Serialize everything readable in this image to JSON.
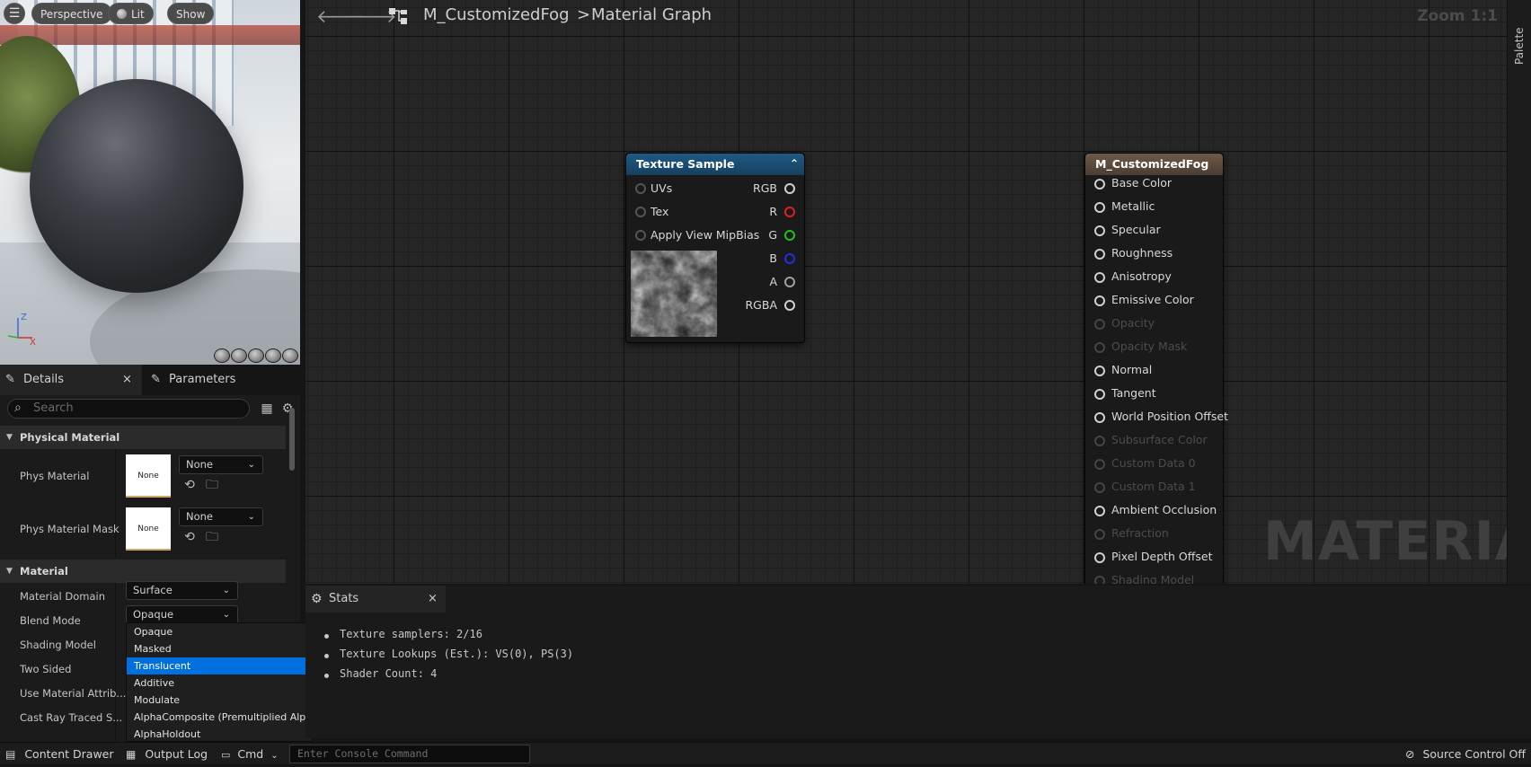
{
  "viewport": {
    "buttons": {
      "perspective": "Perspective",
      "lit": "Lit",
      "show": "Show"
    },
    "axis": {
      "z": "Z",
      "x": "X"
    }
  },
  "details": {
    "tabs": {
      "details": "Details",
      "parameters": "Parameters"
    },
    "search_placeholder": "Search",
    "sections": {
      "physical_material": "Physical Material",
      "material": "Material"
    },
    "phys_material": {
      "label": "Phys Material",
      "thumb": "None",
      "value": "None"
    },
    "phys_material_mask": {
      "label": "Phys Material Mask",
      "thumb": "None",
      "value": "None"
    },
    "material_domain": {
      "label": "Material Domain",
      "value": "Surface"
    },
    "blend_mode": {
      "label": "Blend Mode",
      "value": "Opaque"
    },
    "shading_model": {
      "label": "Shading Model"
    },
    "two_sided": {
      "label": "Two Sided"
    },
    "use_material_attrib": {
      "label": "Use Material Attrib..."
    },
    "cast_ray_traced": {
      "label": "Cast Ray Traced S..."
    }
  },
  "blend_dropdown": {
    "options": [
      "Opaque",
      "Masked",
      "Translucent",
      "Additive",
      "Modulate",
      "AlphaComposite (Premultiplied Alpha)",
      "AlphaHoldout"
    ],
    "selected": "Translucent"
  },
  "graph": {
    "breadcrumb": {
      "asset": "M_CustomizedFog",
      "separator": ">",
      "graph": "Material Graph"
    },
    "zoom": "Zoom 1:1",
    "watermark": "MATERIAL",
    "palette": "Palette",
    "texture_node": {
      "title": "Texture Sample",
      "inputs": [
        "UVs",
        "Tex",
        "Apply View MipBias"
      ],
      "outputs": [
        "RGB",
        "R",
        "G",
        "B",
        "A",
        "RGBA"
      ]
    },
    "material_node": {
      "title": "M_CustomizedFog",
      "pins": [
        {
          "label": "Base Color",
          "enabled": true
        },
        {
          "label": "Metallic",
          "enabled": true
        },
        {
          "label": "Specular",
          "enabled": true
        },
        {
          "label": "Roughness",
          "enabled": true
        },
        {
          "label": "Anisotropy",
          "enabled": true
        },
        {
          "label": "Emissive Color",
          "enabled": true
        },
        {
          "label": "Opacity",
          "enabled": false
        },
        {
          "label": "Opacity Mask",
          "enabled": false
        },
        {
          "label": "Normal",
          "enabled": true
        },
        {
          "label": "Tangent",
          "enabled": true
        },
        {
          "label": "World Position Offset",
          "enabled": true
        },
        {
          "label": "Subsurface Color",
          "enabled": false
        },
        {
          "label": "Custom Data 0",
          "enabled": false
        },
        {
          "label": "Custom Data 1",
          "enabled": false
        },
        {
          "label": "Ambient Occlusion",
          "enabled": true
        },
        {
          "label": "Refraction",
          "enabled": false
        },
        {
          "label": "Pixel Depth Offset",
          "enabled": true
        },
        {
          "label": "Shading Model",
          "enabled": false
        }
      ]
    },
    "colors": {
      "texture_header": "#1f5a86",
      "material_header": "#6e5a48",
      "pin_r": "#e02020",
      "pin_g": "#20c020",
      "pin_b": "#2030e0"
    }
  },
  "stats": {
    "tab": "Stats",
    "lines": [
      "Texture samplers: 2/16",
      "Texture Lookups (Est.): VS(0), PS(3)",
      "Shader Count: 4"
    ]
  },
  "bottom": {
    "content_drawer": "Content Drawer",
    "output_log": "Output Log",
    "cmd": "Cmd",
    "console_placeholder": "Enter Console Command",
    "source_control": "Source Control Off"
  }
}
